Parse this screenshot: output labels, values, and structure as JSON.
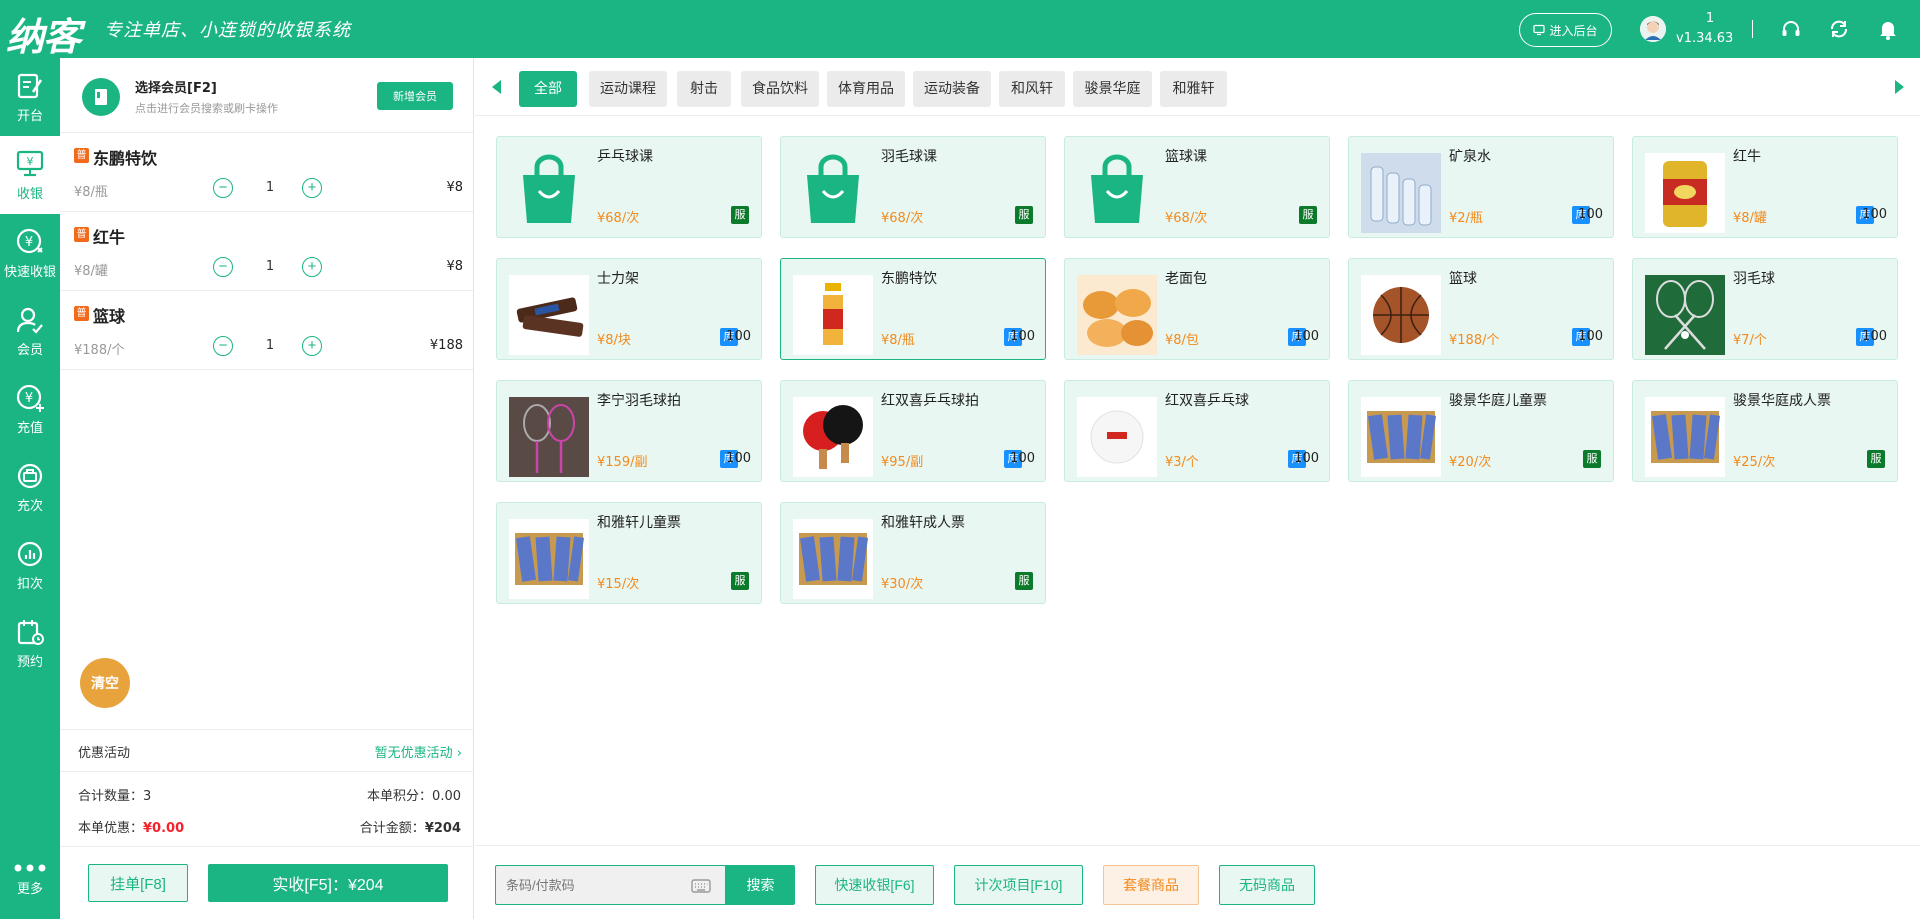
{
  "header": {
    "logo": "纳客",
    "slogan": "专注单店、小连锁的收银系统",
    "admin_button": "进入后台",
    "user_name": "1",
    "version": "v1.34.63",
    "icons": [
      "headset-icon",
      "refresh-icon",
      "bell-icon"
    ]
  },
  "sidebar": {
    "items": [
      {
        "label": "开台",
        "icon": "open-table-icon"
      },
      {
        "label": "收银",
        "icon": "cashier-icon"
      },
      {
        "label": "快速收银",
        "icon": "quick-cashier-icon"
      },
      {
        "label": "会员",
        "icon": "member-icon"
      },
      {
        "label": "充值",
        "icon": "recharge-icon"
      },
      {
        "label": "充次",
        "icon": "charge-times-icon"
      },
      {
        "label": "扣次",
        "icon": "deduct-times-icon"
      },
      {
        "label": "预约",
        "icon": "reservation-icon"
      }
    ],
    "more": "更多",
    "active": "收银"
  },
  "member": {
    "title": "选择会员[F2]",
    "hint": "点击进行会员搜索或刷卡操作",
    "add_button": "新增会员"
  },
  "cart": {
    "items": [
      {
        "tag": "普",
        "name": "东鹏特饮",
        "unit_price": "¥8/瓶",
        "qty": "1",
        "subtotal": "¥8"
      },
      {
        "tag": "普",
        "name": "红牛",
        "unit_price": "¥8/罐",
        "qty": "1",
        "subtotal": "¥8"
      },
      {
        "tag": "普",
        "name": "篮球",
        "unit_price": "¥188/个",
        "qty": "1",
        "subtotal": "¥188"
      }
    ],
    "clear_button": "清空",
    "promo_label": "优惠活动",
    "promo_value": "暂无优惠活动",
    "total_qty_label": "合计数量：",
    "total_qty": "3",
    "points_label": "本单积分：",
    "points": "0.00",
    "discount_label": "本单优惠：",
    "discount": "¥0.00",
    "total_label": "合计金额：",
    "total": "¥204",
    "hold_button": "挂单[F8]",
    "pay_button": "实收[F5]：¥204"
  },
  "categories": [
    "全部",
    "运动课程",
    "射击",
    "食品饮料",
    "体育用品",
    "运动装备",
    "和风轩",
    "骏景华庭",
    "和雅轩"
  ],
  "active_category": "全部",
  "products": [
    {
      "name": "乒乓球课",
      "price": "¥68/次",
      "badge": "服",
      "img": "bag-icon"
    },
    {
      "name": "羽毛球课",
      "price": "¥68/次",
      "badge": "服",
      "img": "bag-icon"
    },
    {
      "name": "篮球课",
      "price": "¥68/次",
      "badge": "服",
      "img": "bag-icon"
    },
    {
      "name": "矿泉水",
      "price": "¥2/瓶",
      "badge": "库",
      "stock": "100",
      "img": "water-image"
    },
    {
      "name": "红牛",
      "price": "¥8/罐",
      "badge": "库",
      "stock": "100",
      "img": "redbull-image"
    },
    {
      "name": "士力架",
      "price": "¥8/块",
      "badge": "库",
      "stock": "100",
      "img": "snickers-image"
    },
    {
      "name": "东鹏特饮",
      "price": "¥8/瓶",
      "badge": "库",
      "stock": "100",
      "img": "dongpeng-image"
    },
    {
      "name": "老面包",
      "price": "¥8/包",
      "badge": "库",
      "stock": "100",
      "img": "bread-image"
    },
    {
      "name": "篮球",
      "price": "¥188/个",
      "badge": "库",
      "stock": "100",
      "img": "basketball-image"
    },
    {
      "name": "羽毛球",
      "price": "¥7/个",
      "badge": "库",
      "stock": "100",
      "img": "badminton-image"
    },
    {
      "name": "李宁羽毛球拍",
      "price": "¥159/副",
      "badge": "库",
      "stock": "100",
      "img": "racket-image"
    },
    {
      "name": "红双喜乒乓球拍",
      "price": "¥95/副",
      "badge": "库",
      "stock": "100",
      "img": "paddle-image"
    },
    {
      "name": "红双喜乒乓球",
      "price": "¥3/个",
      "badge": "库",
      "stock": "100",
      "img": "pingpong-ball-image"
    },
    {
      "name": "骏景华庭儿童票",
      "price": "¥20/次",
      "badge": "服",
      "img": "ticket-image"
    },
    {
      "name": "骏景华庭成人票",
      "price": "¥25/次",
      "badge": "服",
      "img": "ticket-image"
    },
    {
      "name": "和雅轩儿童票",
      "price": "¥15/次",
      "badge": "服",
      "img": "ticket-image"
    },
    {
      "name": "和雅轩成人票",
      "price": "¥30/次",
      "badge": "服",
      "img": "ticket-image"
    }
  ],
  "selected_product": "东鹏特饮",
  "bottom": {
    "scan_placeholder": "条码/付款码",
    "search_button": "搜索",
    "buttons": [
      "快速收银[F6]",
      "计次项目[F10]",
      "套餐商品",
      "无码商品"
    ]
  },
  "colors": {
    "brand": "#1bb584",
    "price": "#f28a1d",
    "discount": "#f5222d",
    "service_badge": "#0b7a2a",
    "stock_badge": "#1890ff",
    "tag": "#f26b1d",
    "clear": "#e8a33c"
  }
}
